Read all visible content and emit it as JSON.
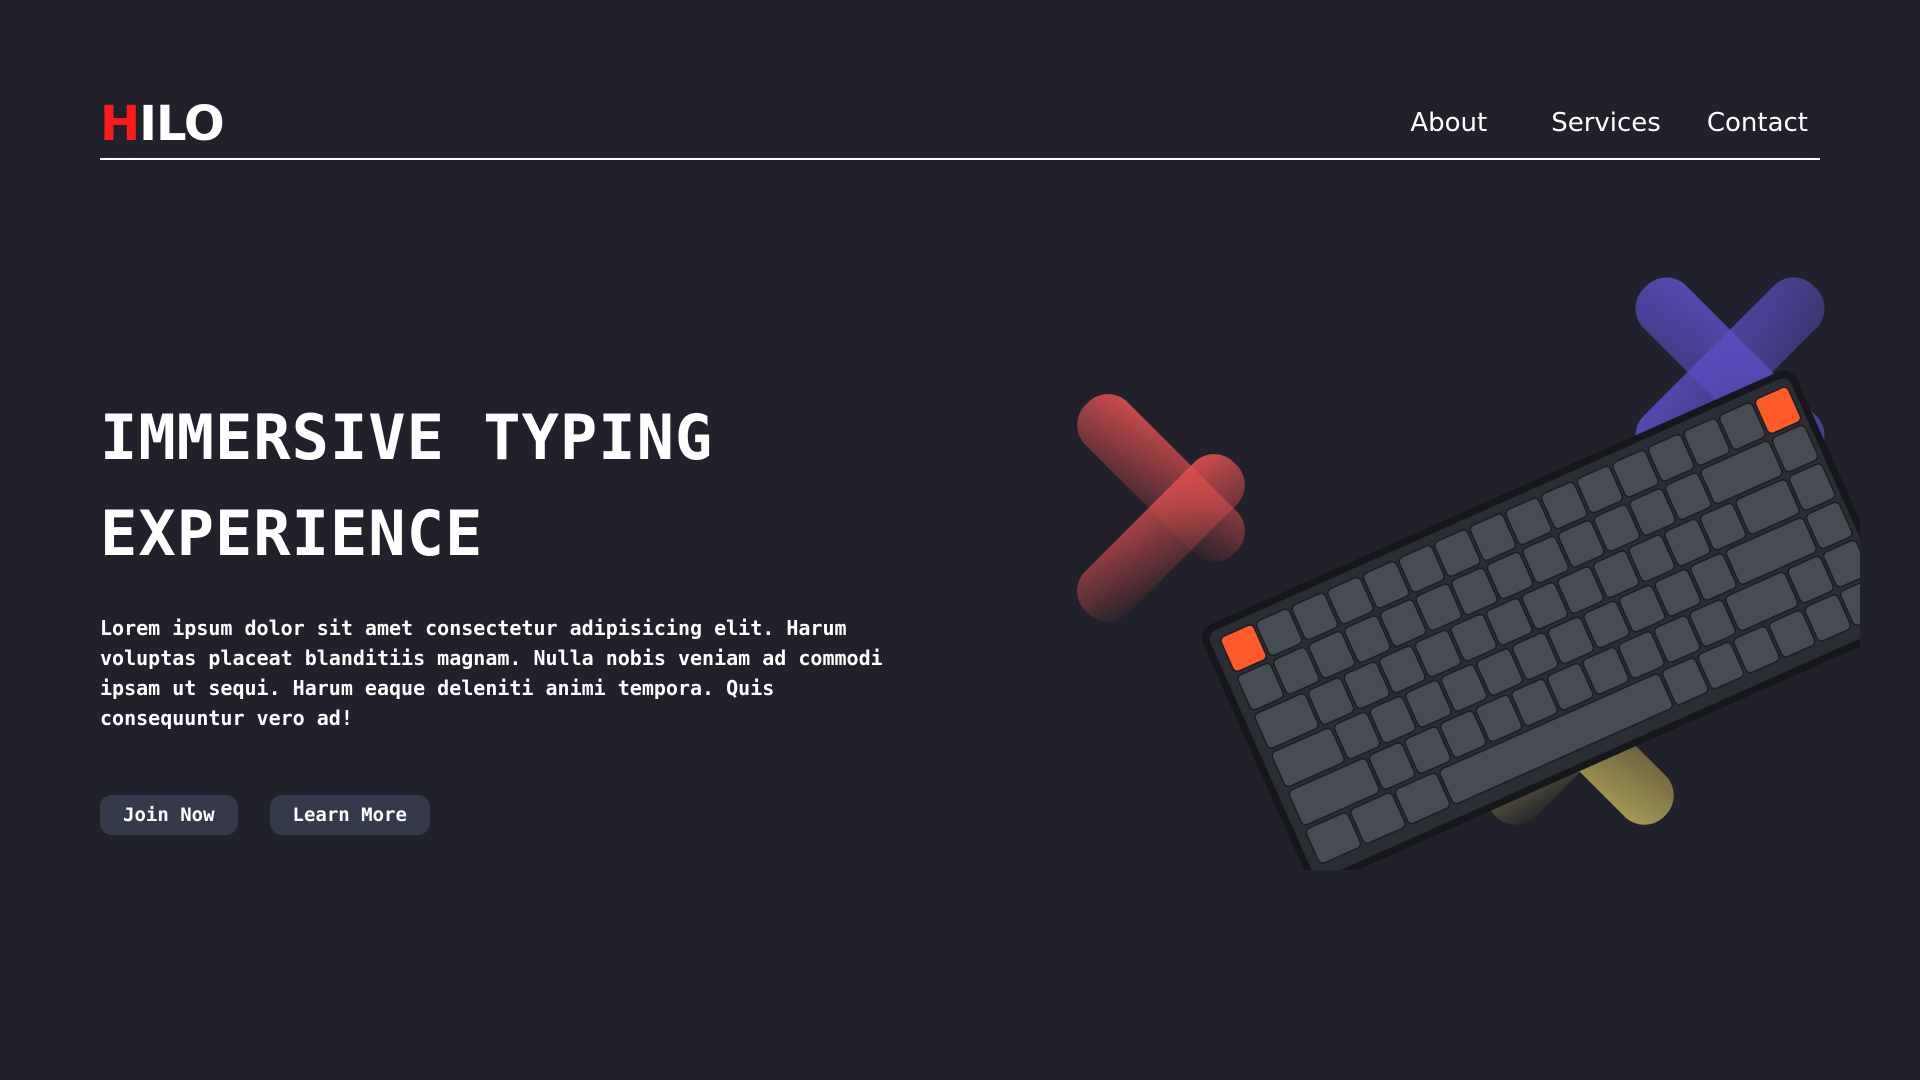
{
  "brand": {
    "logo_first": "H",
    "logo_rest": "ILO",
    "accent_color": "#ff1a1a"
  },
  "nav": {
    "items": [
      {
        "label": "About"
      },
      {
        "label": "Services"
      },
      {
        "label": "Contact"
      }
    ]
  },
  "hero": {
    "title_line1": "IMMERSIVE TYPING",
    "title_line2": "EXPERIENCE",
    "description": "Lorem ipsum dolor sit amet consectetur adipisicing elit. Harum voluptas placeat blanditiis magnam. Nulla nobis veniam ad commodi ipsam ut sequi. Harum eaque deleniti animi tempora. Quis consequuntur vero ad!",
    "buttons": {
      "join_label": "Join Now",
      "learn_label": "Learn More"
    }
  },
  "visual": {
    "image": "mechanical-keyboard",
    "accent_colors": {
      "red_cross": "#e0504f",
      "purple_cross": "#5b4fc4",
      "yellow_cross": "#c2b25a",
      "orange_key": "#ff5a2a"
    }
  },
  "colors": {
    "background": "#20212a",
    "button_bg": "#343a4c",
    "text": "#ffffff"
  }
}
